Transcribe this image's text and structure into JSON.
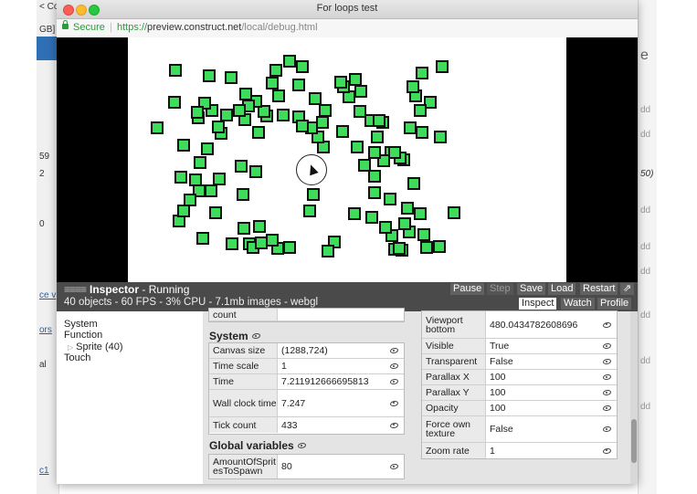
{
  "window": {
    "title": "For loops test",
    "secure_label": "Secure",
    "url_proto": "https://",
    "url_host": "preview.construct.net",
    "url_path": "/local/debug.html"
  },
  "background_app": {
    "left_fragments": [
      "< Co",
      "GB]",
      "59",
      "2",
      "0",
      "ce v",
      "ors",
      "al",
      "c1"
    ],
    "right_fragments": [
      "dd",
      "dd",
      "50)",
      "dd",
      "dd",
      "dd",
      "dd",
      "dd",
      "dd"
    ]
  },
  "inspector": {
    "lines": "≡≡≡≡",
    "title": "Inspector",
    "state": " - Running",
    "stats": "40 objects - 60 FPS - 3% CPU - 7.1mb images - webgl",
    "buttons": {
      "pause": "Pause",
      "step": "Step",
      "save": "Save",
      "load": "Load",
      "restart": "Restart",
      "popout": "⇗"
    },
    "tabs": {
      "inspect": "Inspect",
      "watch": "Watch",
      "profile": "Profile"
    }
  },
  "tree": {
    "system": "System",
    "function": "Function",
    "sprite": "Sprite (40)",
    "touch": "Touch"
  },
  "mid": {
    "prev_row": "count",
    "system_title": "System",
    "system_rows": [
      {
        "name": "Canvas size",
        "value": "(1288,724)"
      },
      {
        "name": "Time scale",
        "value": "1"
      },
      {
        "name": "Time",
        "value": "7.211912666695813"
      },
      {
        "name": "Wall clock time",
        "value": "7.247"
      },
      {
        "name": "Tick count",
        "value": "433"
      }
    ],
    "globals_title": "Global variables",
    "globals_rows": [
      {
        "name": "AmountOfSpritesToSpawn",
        "value": "80"
      }
    ]
  },
  "right": {
    "rows": [
      {
        "name": "Viewport bottom",
        "value": "480.0434782608696"
      },
      {
        "name": "Visible",
        "value": "True"
      },
      {
        "name": "Transparent",
        "value": "False"
      },
      {
        "name": "Parallax X",
        "value": "100"
      },
      {
        "name": "Parallax Y",
        "value": "100"
      },
      {
        "name": "Opacity",
        "value": "100"
      },
      {
        "name": "Force own texture",
        "value": "False"
      },
      {
        "name": "Zoom rate",
        "value": "1"
      }
    ]
  },
  "colors": {
    "sprite_fill": "#3ddc5a",
    "inspector_bar": "#4a4a4a",
    "secure_green": "#2c9b3c"
  }
}
